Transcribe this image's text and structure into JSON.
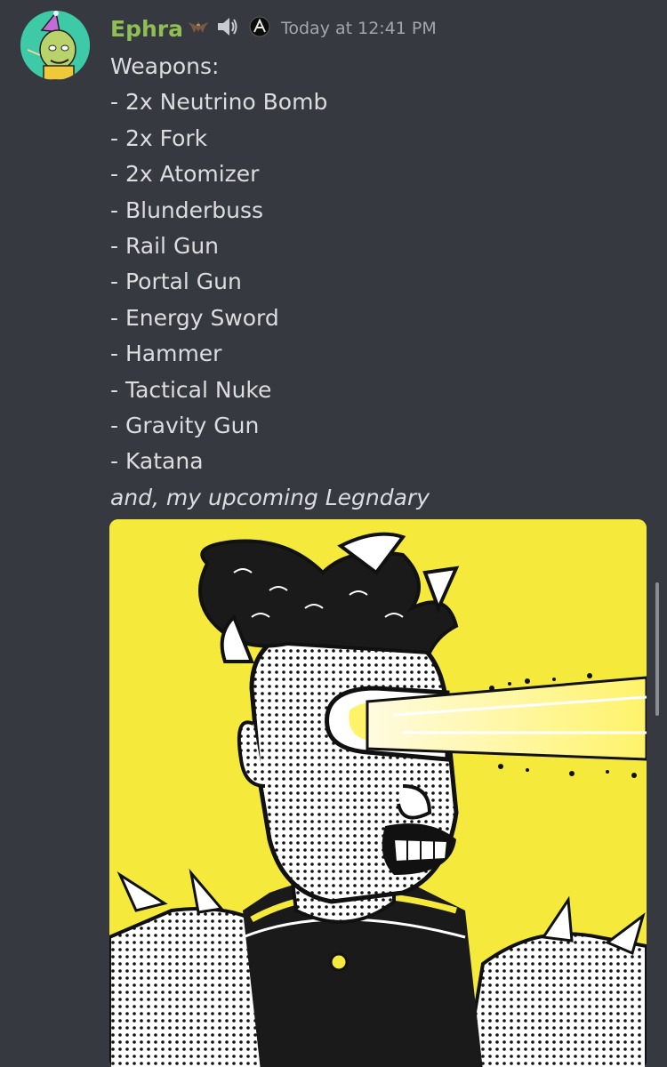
{
  "message": {
    "author": "Ephra",
    "timestamp": "Today at 12:41 PM",
    "badges": [
      "bat-icon",
      "speaker-icon",
      "edge-icon"
    ],
    "lines": [
      "Weapons:",
      "- 2x Neutrino Bomb",
      "- 2x Fork",
      "- 2x Atomizer",
      "- Blunderbuss",
      "- Rail Gun",
      "- Portal Gun",
      "- Energy Sword",
      "- Hammer",
      "- Tactical Nuke",
      "- Gravity Gun",
      "- Katana"
    ],
    "emphasis_line": "and, my upcoming Legndary"
  },
  "colors": {
    "background": "#36393f",
    "username": "#8fbf54",
    "text": "#dcddde",
    "timestamp": "#a3a6aa",
    "attachment_background": "#f5ea3c"
  },
  "attachment": {
    "type": "image",
    "subject": "comic character firing a yellow laser beam from visor"
  }
}
